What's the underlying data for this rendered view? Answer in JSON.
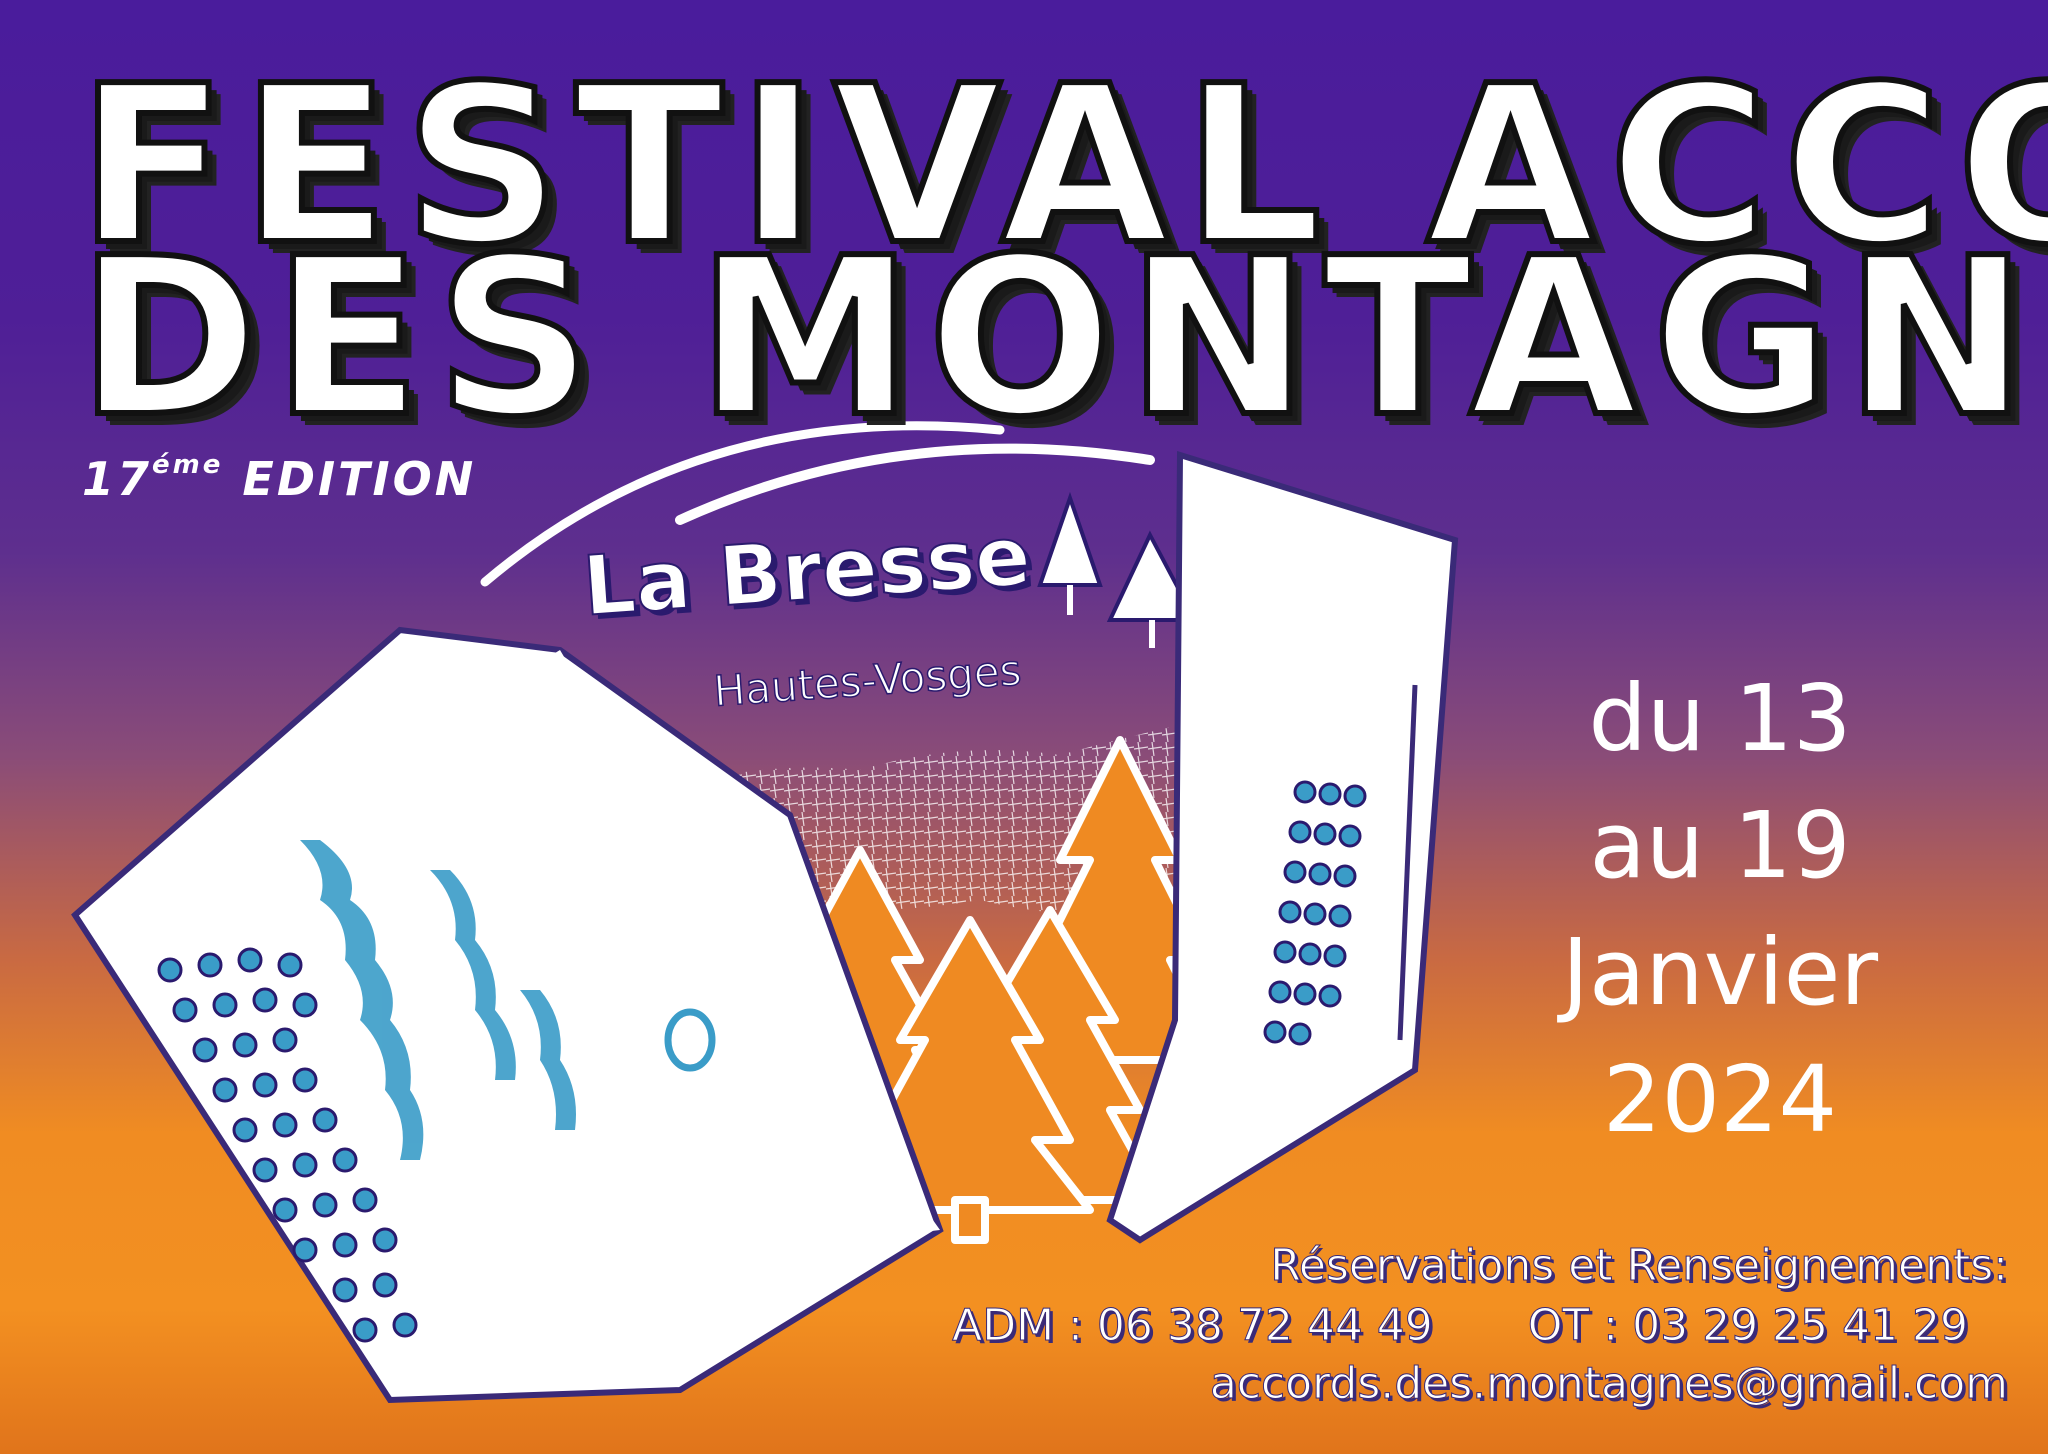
{
  "poster": {
    "title_line1": "FESTIVAL ACCORDS",
    "title_line2": "DES MONTAGNES",
    "edition_number": "17",
    "edition_suffix": "éme",
    "edition_word": "EDITION",
    "dates": {
      "line1": "du 13",
      "line2": "au 19",
      "line3": "Janvier",
      "line4": "2024"
    },
    "logo": {
      "name": "La Bresse",
      "region": "Hautes-Vosges"
    },
    "contact": {
      "heading": "Réservations et Renseignements:",
      "adm": "ADM : 06 38 72 44 49",
      "ot": "OT : 03 29 25 41 29",
      "email": "accords.des.montagnes@gmail.com"
    },
    "colors": {
      "top": "#4a1c9c",
      "bottom": "#f08c22",
      "text": "#ffffff",
      "accent": "#3a9cc8"
    },
    "icons": [
      "accordion-illustration",
      "pine-tree-icon",
      "fir-forest-illustration"
    ]
  }
}
